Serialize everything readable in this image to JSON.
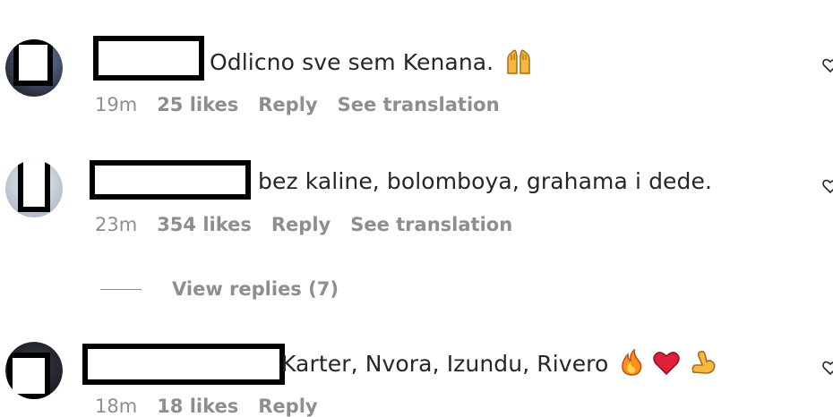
{
  "comments": [
    {
      "text": "Odlicno sve sem Kenana.",
      "emoji_icons": [
        "raising-hands-emoji"
      ],
      "time": "19m",
      "likes": "25 likes",
      "reply": "Reply",
      "translate": "See translation"
    },
    {
      "text": "bez kaline, bolomboya, grahama i dede.",
      "emoji_icons": [],
      "time": "23m",
      "likes": "354 likes",
      "reply": "Reply",
      "translate": "See translation"
    },
    {
      "text": "Karter, Nvora, Izundu, Rivero",
      "emoji_icons": [
        "fire-emoji",
        "red-heart-emoji",
        "flexed-biceps-emoji"
      ],
      "time": "18m",
      "likes": "18 likes",
      "reply": "Reply",
      "translate": ""
    }
  ],
  "view_replies": "View replies (7)",
  "colors": {
    "text": "#262626",
    "meta": "#8e8e8e",
    "redaction": "#000000"
  }
}
